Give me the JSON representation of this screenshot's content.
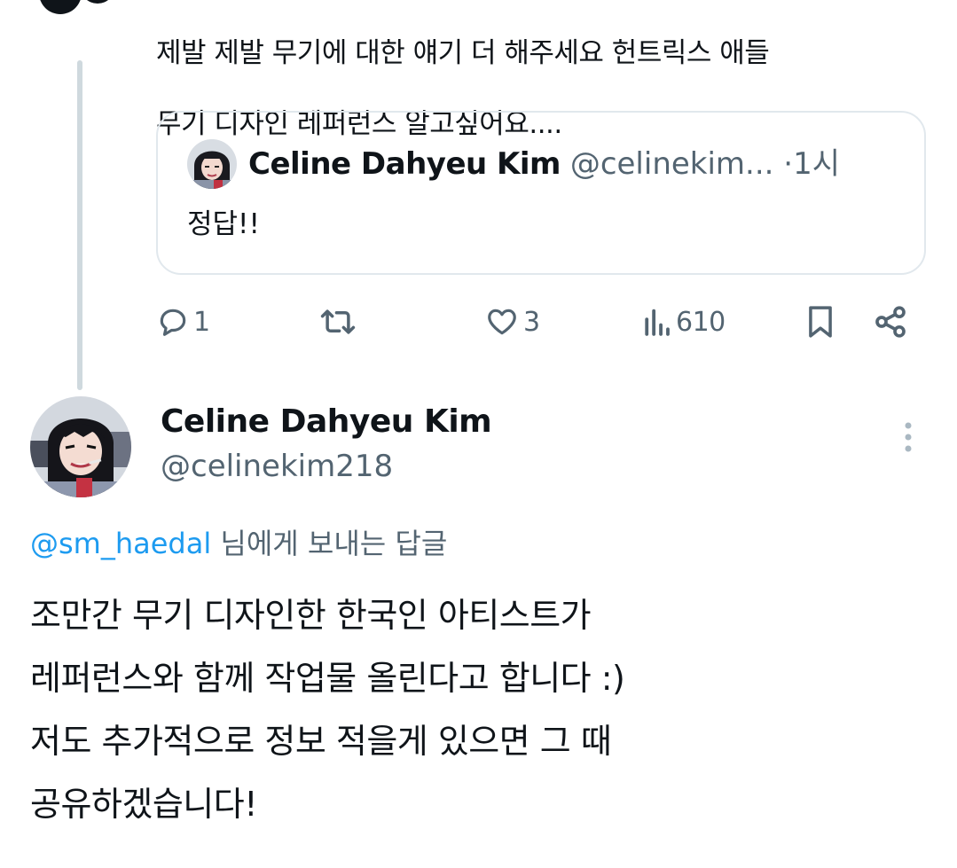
{
  "parent_tweet": {
    "text_lines": [
      "제발 제발 무기에 대한 얘기 더 해주세요 헌트릭스 애들",
      "무기 디자인 레퍼런스 알고싶어요...."
    ],
    "quoted_tweet": {
      "display_name": "Celine Dahyeu Kim",
      "handle": "@celinekim...",
      "separator": "·",
      "time": "1시",
      "text": "정답!!"
    },
    "actions": {
      "reply_icon": "speech-bubble-icon",
      "reply_count": "1",
      "retweet_icon": "retweet-icon",
      "like_icon": "heart-icon",
      "like_count": "3",
      "views_icon": "bar-chart-icon",
      "view_count": "610",
      "bookmark_icon": "bookmark-icon",
      "share_icon": "share-icon"
    }
  },
  "reply_tweet": {
    "display_name": "Celine Dahyeu Kim",
    "handle": "@celinekim218",
    "more_icon": "vertical-dots-icon",
    "replying_to_mention": "@sm_haedal",
    "replying_to_suffix": "님에게 보내는 답글",
    "body_lines": [
      "조만간 무기 디자인한 한국인 아티스트가",
      "레퍼런스와 함께 작업물 올린다고 합니다 :)",
      "저도 추가적으로 정보 적을게 있으면 그 때",
      "공유하겠습니다!"
    ]
  },
  "colors": {
    "text_primary": "#0f1419",
    "text_secondary": "#536471",
    "link": "#1d9bf0",
    "border": "#e1e8ed",
    "thread_line": "#cfd9de"
  }
}
